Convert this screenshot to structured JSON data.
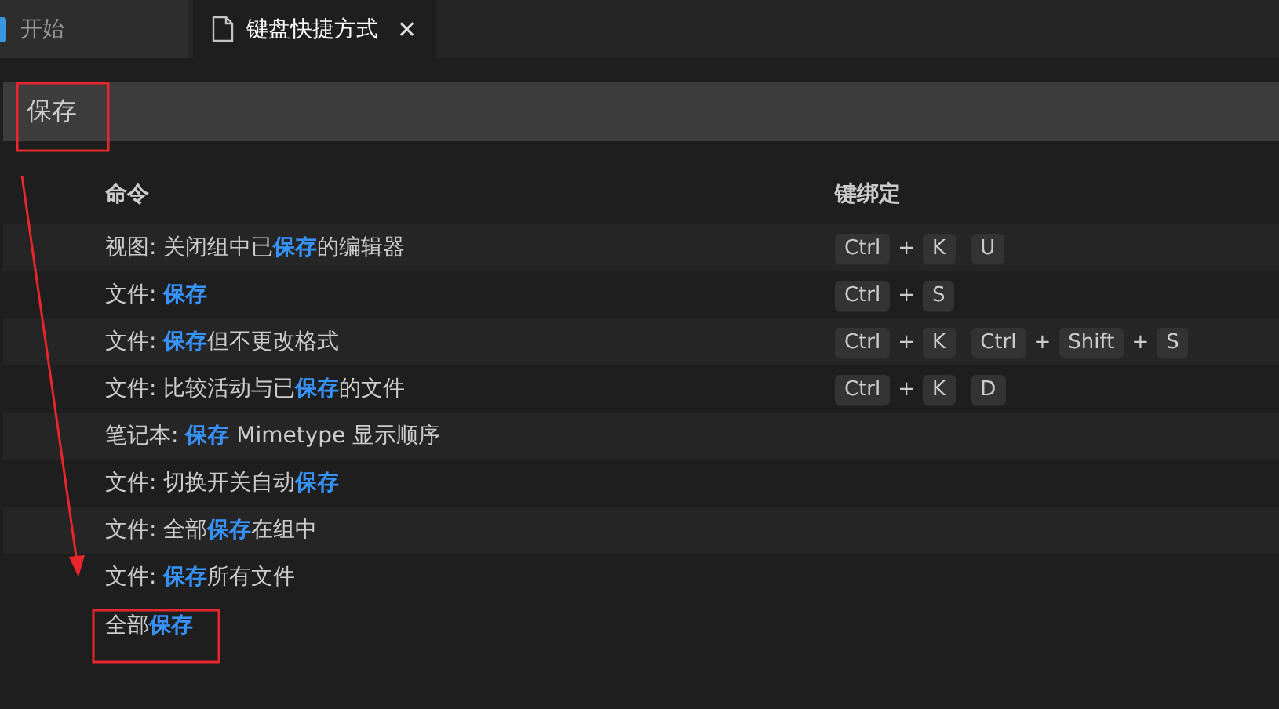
{
  "tabs": [
    {
      "label": "开始",
      "selected": false,
      "kind": "app"
    },
    {
      "label": "键盘快捷方式",
      "selected": true,
      "kind": "file",
      "close": "✕"
    }
  ],
  "search": {
    "value": "保存"
  },
  "table": {
    "columns": [
      "命令",
      "键绑定"
    ],
    "rows": [
      {
        "command": "视图: 关闭组中已**保存**的编辑器",
        "keybinding": [
          [
            "Ctrl",
            "+",
            "K"
          ],
          [
            "U"
          ]
        ]
      },
      {
        "command": "文件: **保存**",
        "keybinding": [
          [
            "Ctrl",
            "+",
            "S"
          ]
        ]
      },
      {
        "command": "文件: **保存**但不更改格式",
        "keybinding": [
          [
            "Ctrl",
            "+",
            "K"
          ],
          [
            "Ctrl",
            "+",
            "Shift",
            "+",
            "S"
          ]
        ]
      },
      {
        "command": "文件: 比较活动与已**保存**的文件",
        "keybinding": [
          [
            "Ctrl",
            "+",
            "K"
          ],
          [
            "D"
          ]
        ]
      },
      {
        "command": "笔记本: **保存** Mimetype 显示顺序",
        "keybinding": []
      },
      {
        "command": "文件: 切换开关自动**保存**",
        "keybinding": []
      },
      {
        "command": "文件: 全部**保存**在组中",
        "keybinding": []
      },
      {
        "command": "文件: **保存**所有文件",
        "keybinding": []
      }
    ]
  },
  "suggestion": "全部**保存**"
}
